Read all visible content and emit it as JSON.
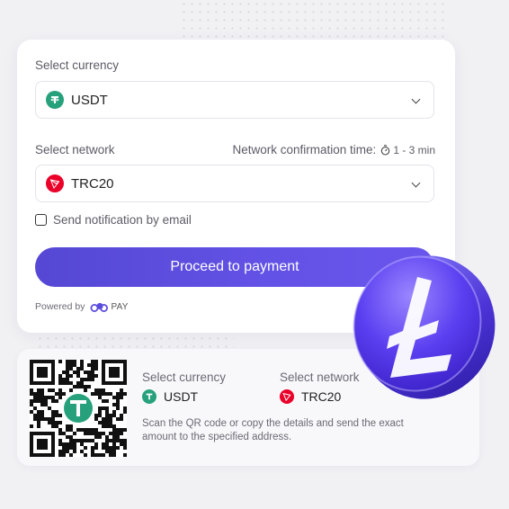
{
  "form": {
    "currency_label": "Select currency",
    "currency_value": "USDT",
    "network_label": "Select network",
    "confirmation_label": "Network confirmation time:",
    "confirmation_time": "1 - 3 min",
    "network_value": "TRC20",
    "notify_label": "Send notification by email",
    "notify_checked": false,
    "proceed_label": "Proceed to payment",
    "powered_by": "Powered by",
    "pay_brand": "PAY"
  },
  "details": {
    "currency_label": "Select currency",
    "currency_value": "USDT",
    "network_label": "Select network",
    "network_value": "TRC20",
    "instructions": "Scan the QR code or copy the details and send the exact amount to the specified address."
  },
  "icons": {
    "currency": "usdt-icon",
    "network": "tron-icon",
    "timer": "timer-icon",
    "chevron": "chevron-down-icon",
    "brand": "cloud-logo-icon",
    "decor": "litecoin-coin-icon"
  },
  "colors": {
    "accent": "#5b4ddc",
    "usdt": "#26a17b",
    "tron": "#eb0029",
    "background": "#f1f1f4"
  }
}
